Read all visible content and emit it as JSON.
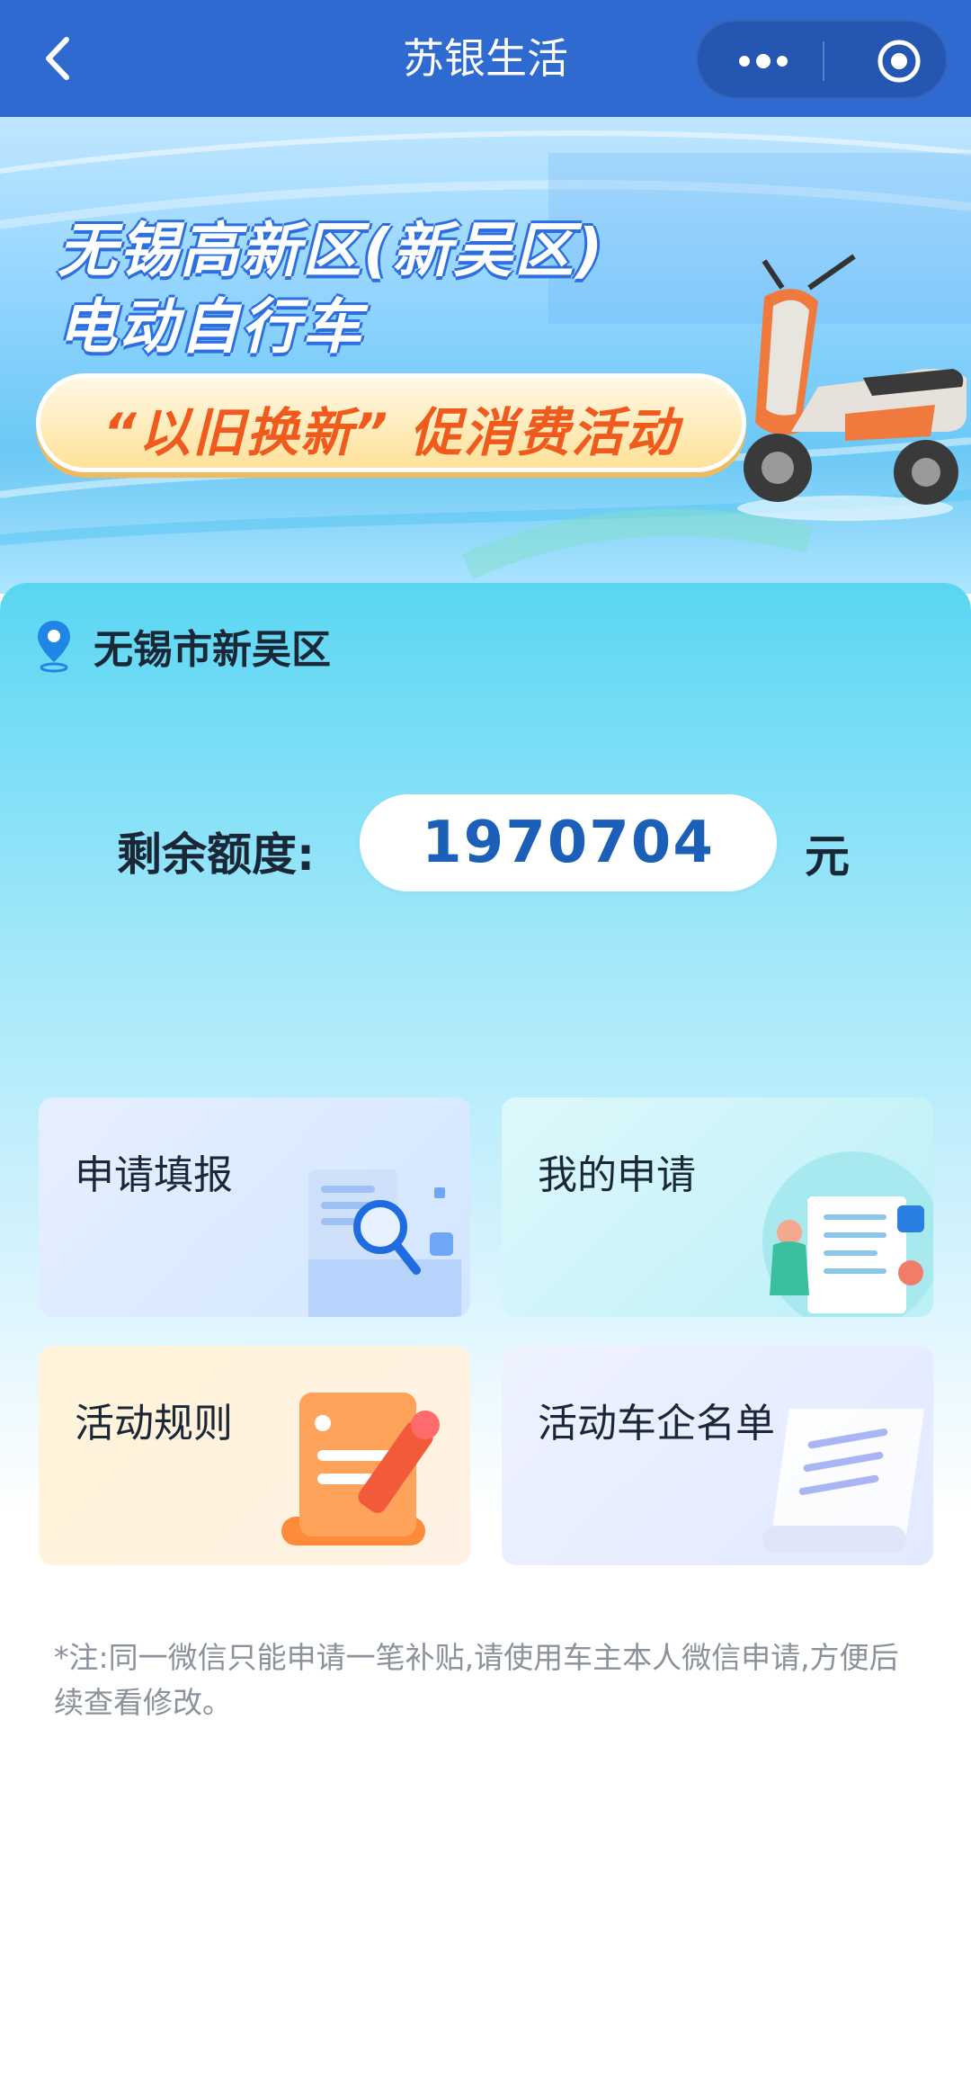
{
  "header": {
    "title": "苏银生活",
    "icons": {
      "back": "chevron-left-icon",
      "more": "more-dots-icon",
      "close": "close-target-icon"
    }
  },
  "banner": {
    "line1": "无锡高新区(新吴区)",
    "line2": "电动自行车",
    "pill": "“以旧换新” 促消费活动"
  },
  "location": {
    "icon": "location-pin-icon",
    "text": "无锡市新吴区"
  },
  "quota": {
    "label": "剩余额度:",
    "value": "1970704",
    "unit": "元"
  },
  "tiles": [
    {
      "label": "申请填报",
      "icon": "search-document-icon"
    },
    {
      "label": "我的申请",
      "icon": "person-checklist-icon"
    },
    {
      "label": "活动规则",
      "icon": "scroll-pencil-icon"
    },
    {
      "label": "活动车企名单",
      "icon": "paper-scroll-icon"
    }
  ],
  "note": "*注:同一微信只能申请一笔补贴,请使用车主本人微信申请,方便后续查看修改。",
  "colors": {
    "header": "#2f6ad0",
    "accent": "#1b5fb8",
    "orange": "#f05a1c"
  }
}
